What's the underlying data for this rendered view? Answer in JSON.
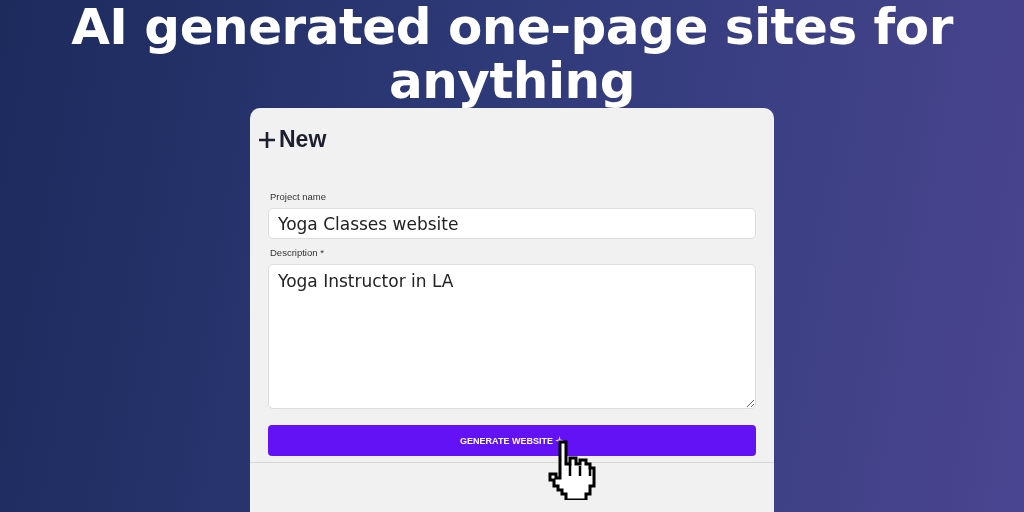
{
  "headline": [
    "AI generated one-page sites for",
    "anything"
  ],
  "form": {
    "title": "New",
    "project_name": {
      "label": "Project name",
      "value": "Yoga Classes website"
    },
    "description": {
      "label": "Description *",
      "value": "Yoga Instructor in LA"
    },
    "button": "GENERATE WEBSITE"
  }
}
